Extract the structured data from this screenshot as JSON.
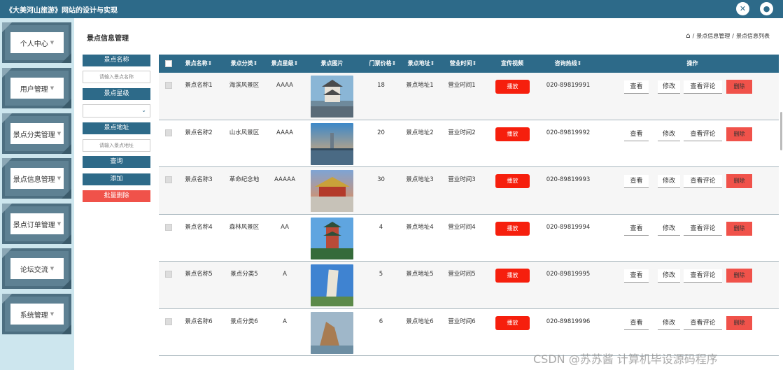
{
  "app": {
    "title": "《大美河山旅游》网站的设计与实现"
  },
  "sidebar": {
    "items": [
      {
        "label": "个人中心"
      },
      {
        "label": "用户管理"
      },
      {
        "label": "景点分类管理"
      },
      {
        "label": "景点信息管理"
      },
      {
        "label": "景点订单管理"
      },
      {
        "label": "论坛交流"
      },
      {
        "label": "系统管理"
      }
    ]
  },
  "page": {
    "title": "景点信息管理",
    "breadcrumb": [
      "景点信息管理",
      "景点信息列表"
    ],
    "breadcrumb_sep": "/"
  },
  "search": {
    "name_label": "景点名称",
    "name_placeholder": "请输入景点名称",
    "level_label": "景点星级",
    "level_value": "",
    "address_label": "景点地址",
    "address_placeholder": "请输入景点地址",
    "query_label": "查询",
    "add_label": "添加",
    "batch_delete_label": "批量删除"
  },
  "table": {
    "headers": [
      "景点名称",
      "景点分类",
      "景点星级",
      "景点图片",
      "门票价格",
      "景点地址",
      "营业时间",
      "宣传视频",
      "咨询热线",
      "操作"
    ],
    "sortable": [
      true,
      true,
      true,
      false,
      true,
      true,
      true,
      false,
      true,
      false
    ],
    "play_label": "播放",
    "actions": {
      "view": "查看",
      "edit": "修改",
      "comments": "查看评论",
      "delete": "删除"
    },
    "rows": [
      {
        "name": "景点名称1",
        "category": "海滨风景区",
        "level": "AAAA",
        "price": "18",
        "address": "景点地址1",
        "hours": "营业时间1",
        "phone": "020-89819991"
      },
      {
        "name": "景点名称2",
        "category": "山水风景区",
        "level": "AAAA",
        "price": "20",
        "address": "景点地址2",
        "hours": "营业时间2",
        "phone": "020-89819992"
      },
      {
        "name": "景点名称3",
        "category": "革命纪念地",
        "level": "AAAAA",
        "price": "30",
        "address": "景点地址3",
        "hours": "营业时间3",
        "phone": "020-89819993"
      },
      {
        "name": "景点名称4",
        "category": "森林风景区",
        "level": "AA",
        "price": "4",
        "address": "景点地址4",
        "hours": "营业时间4",
        "phone": "020-89819994"
      },
      {
        "name": "景点名称5",
        "category": "景点分类5",
        "level": "A",
        "price": "5",
        "address": "景点地址5",
        "hours": "营业时间5",
        "phone": "020-89819995"
      },
      {
        "name": "景点名称6",
        "category": "景点分类6",
        "level": "A",
        "price": "6",
        "address": "景点地址6",
        "hours": "营业时间6",
        "phone": "020-89819996"
      }
    ]
  },
  "watermark": "CSDN @苏苏酱    计算机毕设源码程序",
  "colors": {
    "primary": "#2d6a89",
    "danger": "#f0524a",
    "play": "#f61f0d",
    "sidebar_bg": "#cde6ee"
  }
}
